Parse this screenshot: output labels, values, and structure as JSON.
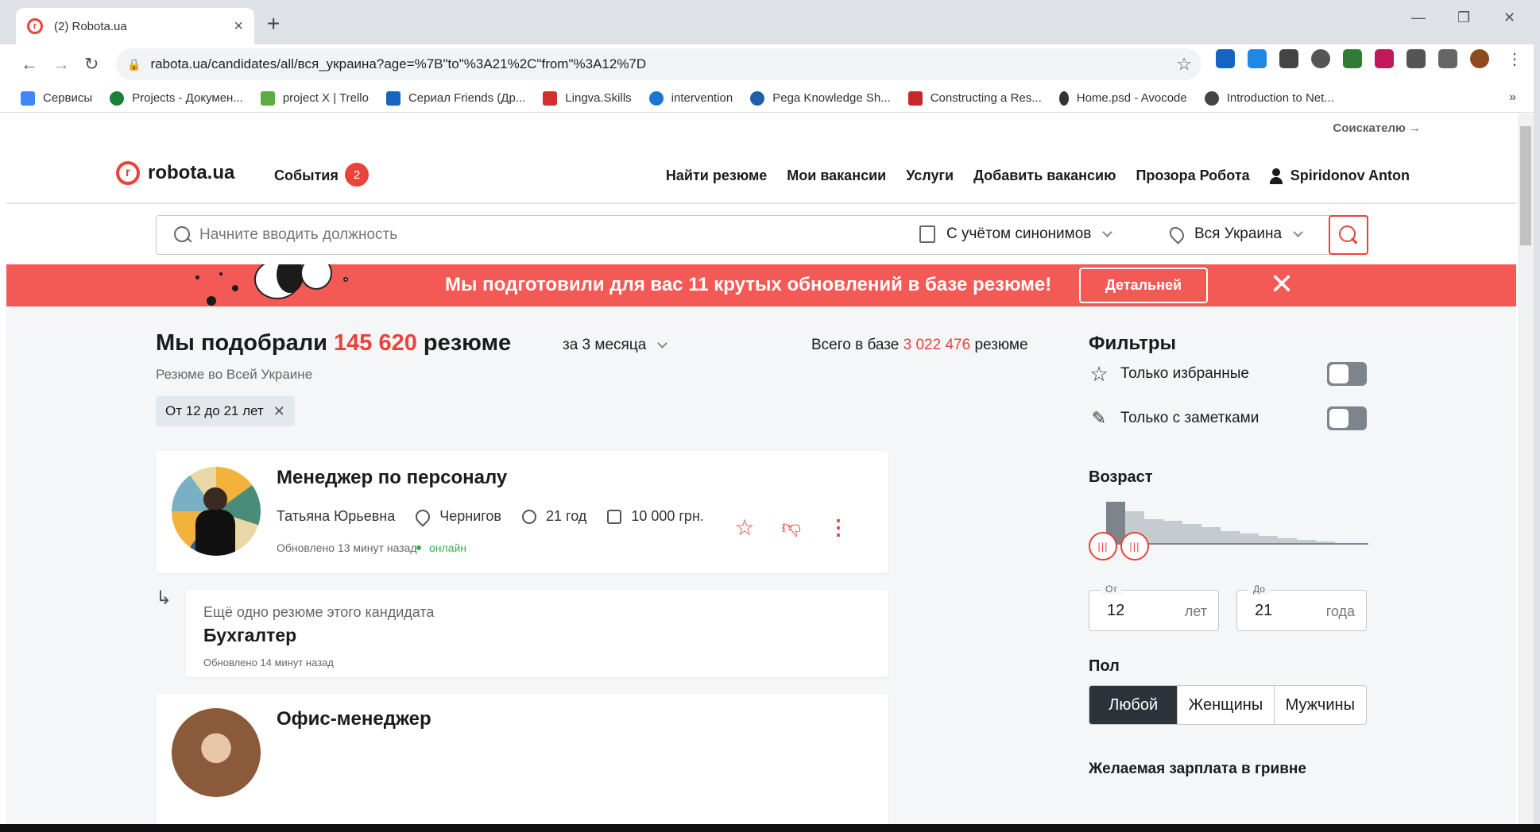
{
  "browser": {
    "tab_title": "(2) Robota.ua",
    "tab_close": "×",
    "new_tab": "+",
    "url": "rabota.ua/candidates/all/вся_украина?age=%7B\"to\"%3A21%2C\"from\"%3A12%7D",
    "bookmarks": [
      {
        "label": "Сервисы",
        "color": "#4285f4"
      },
      {
        "label": "Projects - Докумен...",
        "color": "#1a7f37"
      },
      {
        "label": "project X | Trello",
        "color": "#5aac44"
      },
      {
        "label": "Сериал Friends (Др...",
        "color": "#1565c0"
      },
      {
        "label": "Lingva.Skills",
        "color": "#d32f2f"
      },
      {
        "label": "intervention",
        "color": "#1976d2"
      },
      {
        "label": "Pega Knowledge Sh...",
        "color": "#1e5fa8"
      },
      {
        "label": "Constructing a Res...",
        "color": "#c62828"
      },
      {
        "label": "Home.psd - Avocode",
        "color": "#333333"
      },
      {
        "label": "Introduction to Net...",
        "color": "#444444"
      }
    ],
    "bookmarks_more": "»"
  },
  "site": {
    "jobseeker_link": "Соискателю →",
    "logo_text": "robota.ua",
    "events_label": "События",
    "events_count": "2",
    "nav": [
      "Найти резюме",
      "Мои вакансии",
      "Услуги",
      "Добавить вакансию",
      "Прозора Робота"
    ],
    "user_name": "Spiridonov Anton",
    "accent": "#e9433a"
  },
  "search": {
    "placeholder": "Начните вводить должность",
    "synonyms": "С учётом синонимов",
    "region": "Вся Украина"
  },
  "banner": {
    "text": "Мы подготовили для вас 11 крутых обновлений в базе резюме!",
    "button": "Детальней",
    "close": "✕"
  },
  "results": {
    "title_prefix": "Мы подобрали",
    "count": "145 620",
    "title_suffix": "резюме",
    "period": "за 3 месяца",
    "total_prefix": "Всего в базе",
    "total_count": "3 022 476",
    "total_suffix": "резюме",
    "subtitle": "Резюме во Всей Украине",
    "chip": "От 12 до 21 лет",
    "chip_close": "✕"
  },
  "cards": [
    {
      "position": "Менеджер по персоналу",
      "name": "Татьяна Юрьевна",
      "city": "Чернигов",
      "age": "21 год",
      "salary": "10 000 грн.",
      "updated": "Обновлено 13 минут назад",
      "status": "онлайн"
    }
  ],
  "another": {
    "label": "Ещё одно резюме этого кандидата",
    "position": "Бухгалтер",
    "updated": "Обновлено 14 минут назад"
  },
  "next_card": {
    "position": "Офис-менеджер"
  },
  "filters": {
    "title": "Фильтры",
    "only_favorites": "Только избранные",
    "only_notes": "Только с заметками",
    "age_label": "Возраст",
    "from_label": "От",
    "from_value": "12",
    "from_unit": "лет",
    "to_label": "До",
    "to_value": "21",
    "to_unit": "года",
    "gender_label": "Пол",
    "gender_options": [
      "Любой",
      "Женщины",
      "Мужчины"
    ],
    "gender_selected": "Любой",
    "salary_label": "Желаемая зарплата в гривне"
  }
}
